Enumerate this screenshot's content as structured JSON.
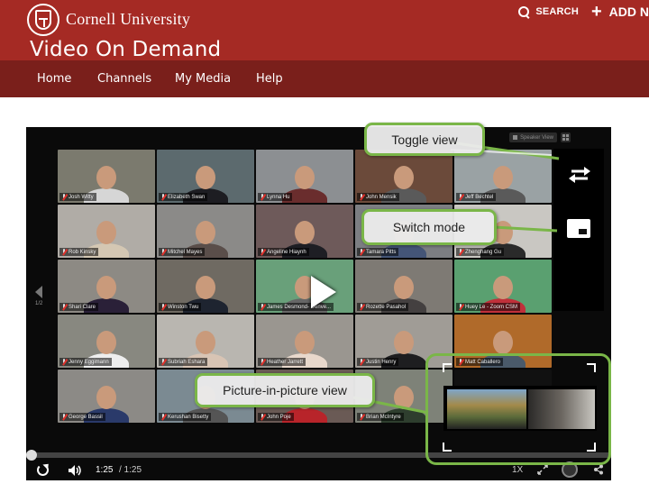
{
  "header": {
    "brand": "Cornell University",
    "site_title": "Video On Demand",
    "search_label": "SEARCH",
    "add_label": "ADD N",
    "colors": {
      "header_bg": "#a52a24",
      "nav_bg": "#7a1f1b",
      "callout_border": "#7ab648"
    }
  },
  "nav": {
    "items": [
      {
        "label": "Home"
      },
      {
        "label": "Channels"
      },
      {
        "label": "My Media"
      },
      {
        "label": "Help"
      }
    ]
  },
  "player": {
    "speaker_view_label": "Speaker View",
    "page_indicator": "1/2",
    "participants": [
      "Josh Witty",
      "Elizabeth Swan",
      "Lynna Hu",
      "John Mensik",
      "Jeff Bechtel",
      "Rob Kinsky",
      "Mitchel Mayes",
      "Angeline Hiaynh",
      "Tamara Pitts",
      "Zhenghang Gu",
      "Shari Clare",
      "Winston Twu",
      "James Desmond- Denve...",
      "Rozette Pasahol",
      "Huey Le - Zoom CSM",
      "Jenny Eggimann",
      "Subriah Eshara",
      "Heather Jarrett",
      "Justin Henry",
      "Matt Caballero",
      "George Bassil",
      "Kerushan Bisetty",
      "John Poje",
      "Brian McIntyre",
      ""
    ],
    "current_time": "1:25",
    "total_time": "/ 1:25",
    "speed": "1X",
    "progress_fraction": 0.0
  },
  "callouts": {
    "toggle_view": "Toggle view",
    "switch_mode": "Switch mode",
    "pip_view": "Picture-in-picture view"
  }
}
